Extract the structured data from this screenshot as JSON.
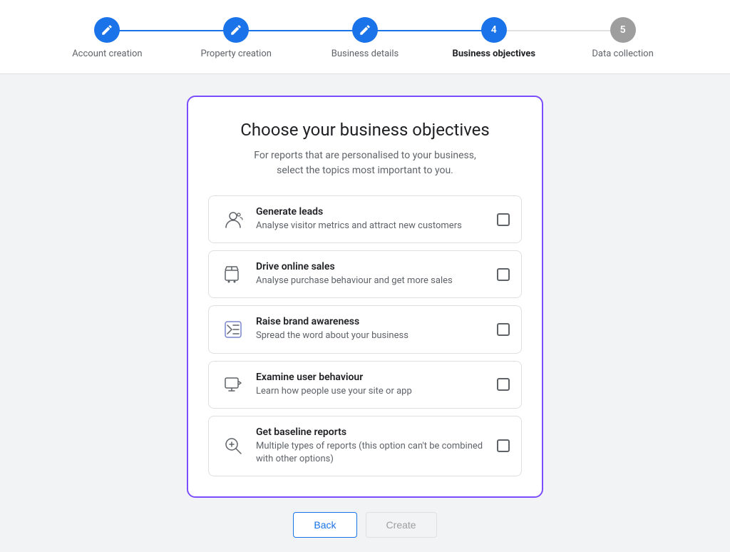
{
  "stepper": {
    "steps": [
      {
        "id": "account-creation",
        "label": "Account creation",
        "state": "completed",
        "number": "✎"
      },
      {
        "id": "property-creation",
        "label": "Property creation",
        "state": "completed",
        "number": "✎"
      },
      {
        "id": "business-details",
        "label": "Business details",
        "state": "completed",
        "number": "✎"
      },
      {
        "id": "business-objectives",
        "label": "Business objectives",
        "state": "active",
        "number": "4"
      },
      {
        "id": "data-collection",
        "label": "Data collection",
        "state": "inactive",
        "number": "5"
      }
    ]
  },
  "card": {
    "title": "Choose your business objectives",
    "subtitle": "For reports that are personalised to your business,\nselect the topics most important to you.",
    "objectives": [
      {
        "id": "generate-leads",
        "title": "Generate leads",
        "description": "Analyse visitor metrics and attract new customers",
        "icon": "leads"
      },
      {
        "id": "drive-online-sales",
        "title": "Drive online sales",
        "description": "Analyse purchase behaviour and get more sales",
        "icon": "sales"
      },
      {
        "id": "raise-brand-awareness",
        "title": "Raise brand awareness",
        "description": "Spread the word about your business",
        "icon": "brand"
      },
      {
        "id": "examine-user-behaviour",
        "title": "Examine user behaviour",
        "description": "Learn how people use your site or app",
        "icon": "behaviour"
      },
      {
        "id": "get-baseline-reports",
        "title": "Get baseline reports",
        "description": "Multiple types of reports (this option can't be combined with other options)",
        "icon": "baseline"
      }
    ]
  },
  "buttons": {
    "back": "Back",
    "create": "Create"
  },
  "colors": {
    "blue": "#1a73e8",
    "purple": "#7c4dff",
    "inactive": "#9e9e9e"
  }
}
